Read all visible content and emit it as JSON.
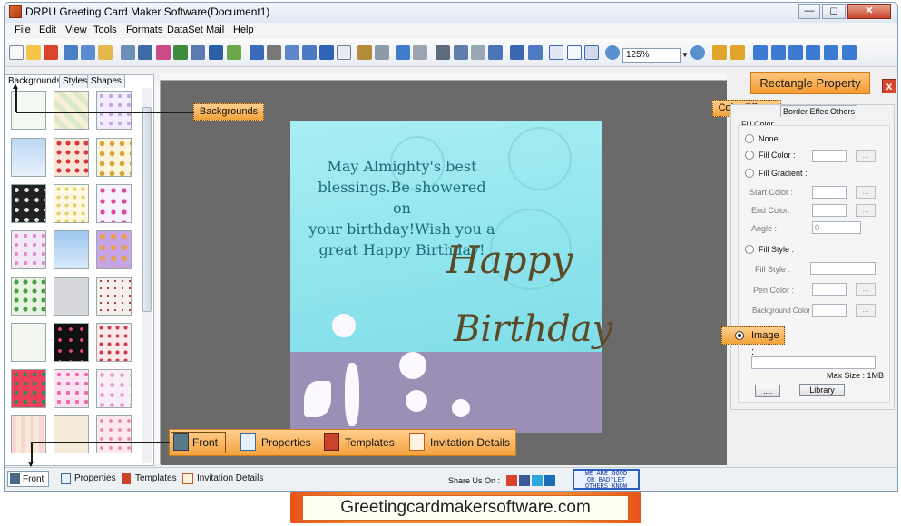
{
  "app": {
    "title": "DRPU Greeting Card Maker Software(Document1)"
  },
  "window_buttons": {
    "minimize": "—",
    "maximize": "◻",
    "close": "✕"
  },
  "menu": [
    "File",
    "Edit",
    "View",
    "Tools",
    "Formats",
    "DataSet",
    "Mail",
    "Help"
  ],
  "toolbar": {
    "zoom_value": "125%"
  },
  "left_panel": {
    "tabs": [
      "Backgrounds",
      "Styles",
      "Shapes"
    ],
    "active_tab": "Backgrounds"
  },
  "callouts": {
    "backgrounds": "Backgrounds",
    "color_effects": "Color Effects",
    "image": "Image :"
  },
  "card": {
    "message_lines": [
      "May Almighty's best",
      "blessings.Be showered on",
      "your birthday!Wish you a",
      "great Happy Birthday!"
    ],
    "script_1": "Happy",
    "script_2": "Birthday"
  },
  "right_panel": {
    "header": "Rectangle Property",
    "close": "x",
    "tabs": [
      "Border Effect",
      "Others"
    ],
    "group_title": "Fill Color",
    "options": {
      "none": "None",
      "fill_color": "Fill Color :",
      "fill_gradient": "Fill Gradient :",
      "start_color": "Start Color :",
      "end_color": "End Color:",
      "angle": "Angle :",
      "angle_value": "0",
      "fill_style": "Fill Style :",
      "fill_style_label": "Fill Style :",
      "pen_color": "Pen Color :",
      "background_color": "Background Color"
    },
    "dots": "...",
    "max_size": "Max Size : 1MB",
    "browse_button": "....",
    "library_button": "Library"
  },
  "bottom_callout": {
    "items": [
      "Front",
      "Properties",
      "Templates",
      "Invitation Details"
    ]
  },
  "status_tabs": [
    "Front",
    "Properties",
    "Templates",
    "Invitation Details"
  ],
  "share": {
    "label": "Share Us On :"
  },
  "badge": {
    "line1": "WE ARE GOOD",
    "line2": "OR BAD?LET",
    "line3": "OTHERS KNOW"
  },
  "banner": {
    "text": "Greetingcardmakersoftware.com"
  },
  "colors": {
    "accent_orange": "#f3a23a",
    "card_teal": "#8be6ee",
    "card_purple": "#9b8fb6"
  }
}
